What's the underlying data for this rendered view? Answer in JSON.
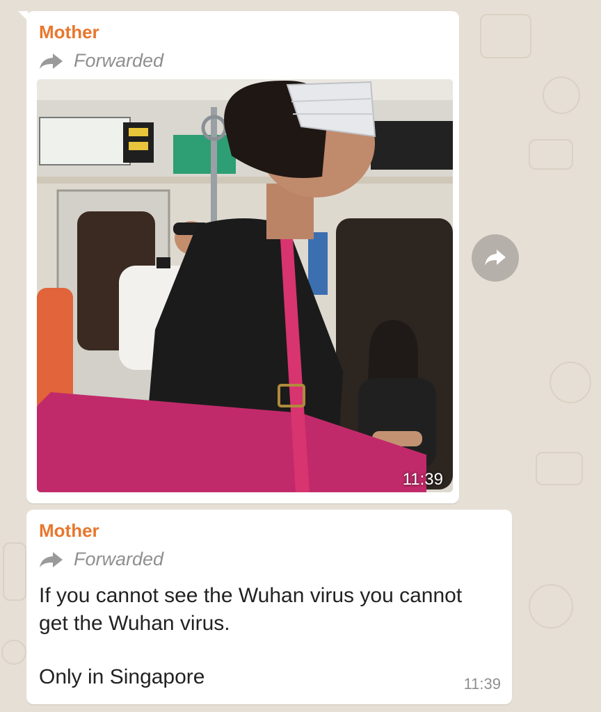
{
  "chat": {
    "messages": [
      {
        "sender": "Mother",
        "forwarded_label": "Forwarded",
        "type": "image",
        "time": "11:39"
      },
      {
        "sender": "Mother",
        "forwarded_label": "Forwarded",
        "type": "text",
        "text_line1": "If you cannot see the Wuhan virus you cannot get the Wuhan virus.",
        "text_line2": "Only in Singapore",
        "time": "11:39"
      }
    ]
  },
  "icons": {
    "forward": "forward-arrow-icon",
    "share": "share-forward-icon"
  },
  "colors": {
    "sender": "#e8772e",
    "wallpaper": "#e6dfd5",
    "bubble": "#ffffff",
    "meta": "#8f8f8f"
  }
}
